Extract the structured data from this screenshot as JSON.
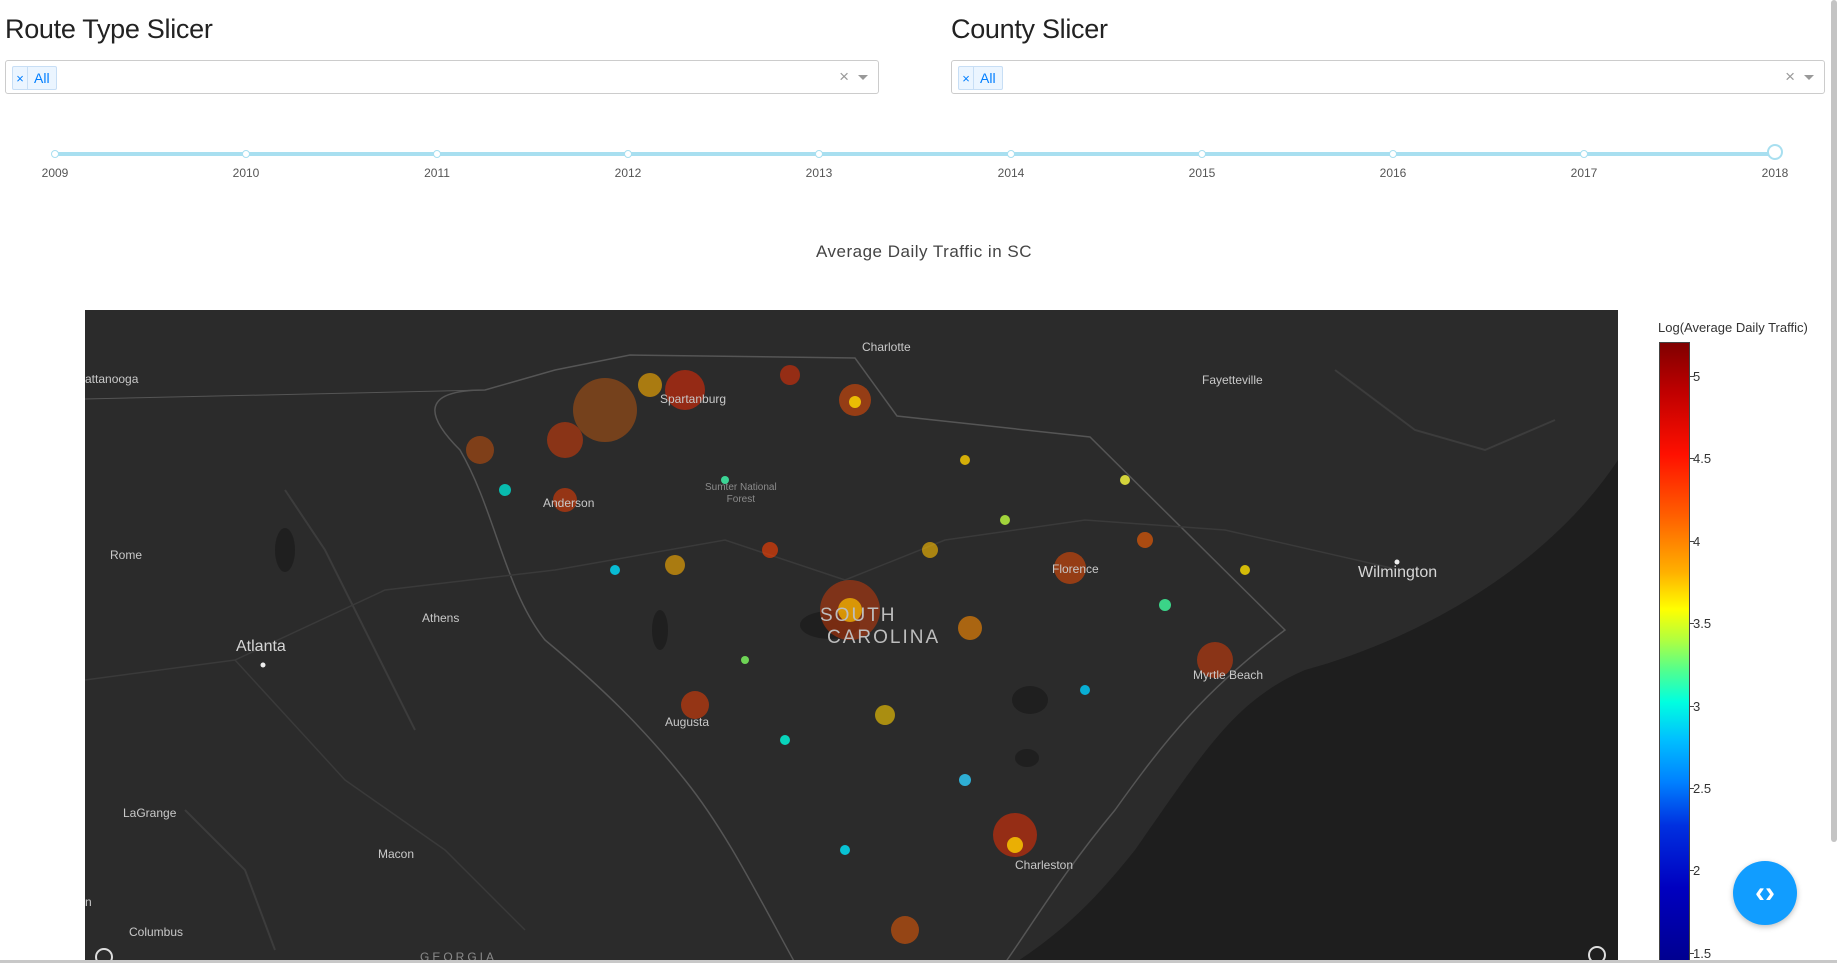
{
  "route_slicer": {
    "title": "Route Type Slicer",
    "chip_label": "All",
    "chip_remove": "×",
    "clear": "×"
  },
  "county_slicer": {
    "title": "County Slicer",
    "chip_label": "All",
    "chip_remove": "×",
    "clear": "×"
  },
  "year_slider": {
    "marks": [
      "2009",
      "2010",
      "2011",
      "2012",
      "2013",
      "2014",
      "2015",
      "2016",
      "2017",
      "2018"
    ],
    "selected": "2018"
  },
  "chart": {
    "title": "Average Daily Traffic in SC"
  },
  "map": {
    "labels": {
      "charlotte": "Charlotte",
      "chattanooga": "attanooga",
      "fayetteville": "Fayetteville",
      "spartanburg": "Spartanburg",
      "anderson": "Anderson",
      "sumter_forest_1": "Sumter National",
      "sumter_forest_2": "Forest",
      "rome": "Rome",
      "athens": "Athens",
      "atlanta": "Atlanta",
      "south": "SOUTH",
      "carolina": "CAROLINA",
      "florence": "Florence",
      "wilmington": "Wilmington",
      "myrtle_beach": "Myrtle Beach",
      "augusta": "Augusta",
      "lagrange": "LaGrange",
      "macon": "Macon",
      "charleston": "Charleston",
      "columbus": "Columbus",
      "georgia": "GEORGIA",
      "edge_n": "n"
    }
  },
  "colorbar": {
    "title": "Log(Average Daily Traffic)",
    "ticks": [
      "5",
      "4.5",
      "4",
      "3.5",
      "3",
      "2.5",
      "2",
      "1.5"
    ]
  },
  "fab": {
    "icon": "code-toggle-icon",
    "label": "‹›"
  },
  "colors": {
    "accent": "#119dff",
    "slider": "#a8dff0",
    "map_bg": "#2b2b2b",
    "chip_text": "#007eff"
  }
}
